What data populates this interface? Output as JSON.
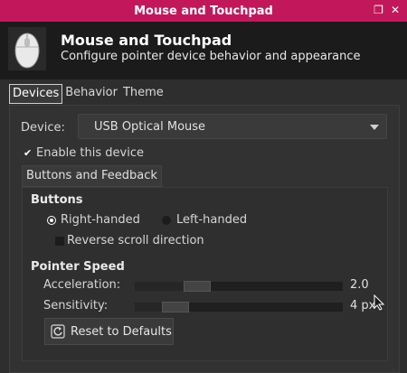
{
  "window": {
    "title": "Mouse and Touchpad"
  },
  "header": {
    "title": "Mouse and Touchpad",
    "subtitle": "Configure pointer device behavior and appearance",
    "icon": "mouse-icon"
  },
  "tabs": [
    {
      "label": "Devices",
      "active": true
    },
    {
      "label": "Behavior",
      "active": false
    },
    {
      "label": "Theme",
      "active": false
    }
  ],
  "device": {
    "label": "Device:",
    "selected": "USB Optical Mouse"
  },
  "enable": {
    "label": "Enable this device",
    "checked": true
  },
  "subtab": {
    "label": "Buttons and Feedback"
  },
  "buttons": {
    "heading": "Buttons",
    "right_handed": "Right-handed",
    "left_handed": "Left-handed",
    "selected": "right",
    "reverse_scroll": "Reverse scroll direction",
    "reverse_scroll_checked": false
  },
  "pointer": {
    "heading": "Pointer Speed",
    "acceleration": {
      "label": "Acceleration:",
      "value": "2.0",
      "fraction": 0.27
    },
    "sensitivity": {
      "label": "Sensitivity:",
      "value": "4 px",
      "fraction": 0.15
    }
  },
  "reset": {
    "label": "Reset to Defaults",
    "icon": "reset-icon"
  },
  "colors": {
    "titlebar": "#c2185b",
    "header": "#1b1b1b",
    "background": "#2e2e2e"
  }
}
